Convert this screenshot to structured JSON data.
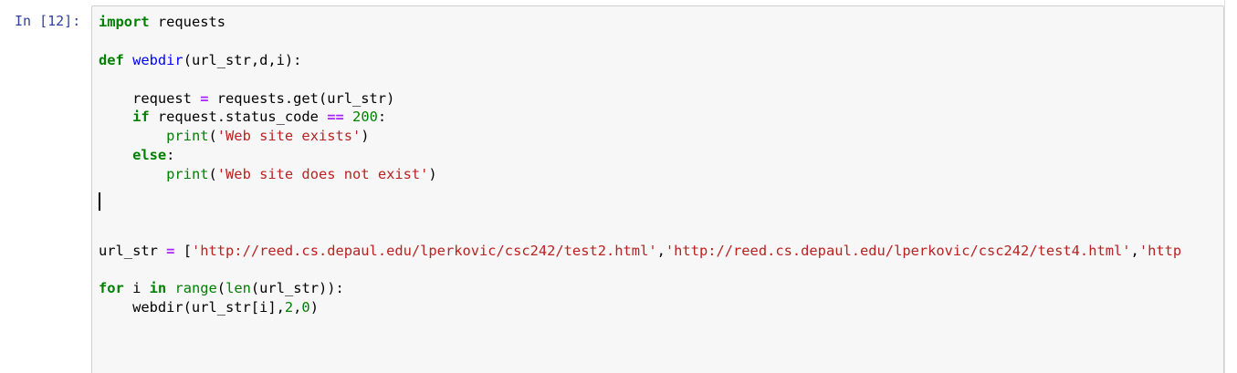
{
  "cell": {
    "prompt": "In [12]:"
  },
  "code": {
    "import_kw": "import",
    "import_mod": " requests",
    "def_kw": "def",
    "def_name": "webdir",
    "def_args": "(url_str,d,i):",
    "req_indent": "    request ",
    "req_op": "=",
    "req_rest": " requests.get(url_str)",
    "if_indent": "    ",
    "if_kw": "if",
    "if_cond": " request.status_code ",
    "if_op": "==",
    "if_sp": " ",
    "if_num": "200",
    "if_colon": ":",
    "p1_indent": "        ",
    "p1_fn": "print",
    "p1_open": "(",
    "p1_str": "'Web site exists'",
    "p1_close": ")",
    "else_indent": "    ",
    "else_kw": "else",
    "else_colon": ":",
    "p2_indent": "        ",
    "p2_fn": "print",
    "p2_open": "(",
    "p2_str": "'Web site does not exist'",
    "p2_close": ")",
    "url_var": "url_str ",
    "url_op": "=",
    "url_open": " [",
    "url_s1": "'http://reed.cs.depaul.edu/lperkovic/csc242/test2.html'",
    "url_c1": ",",
    "url_s2": "'http://reed.cs.depaul.edu/lperkovic/csc242/test4.html'",
    "url_c2": ",",
    "url_s3": "'http",
    "for_kw": "for",
    "for_var": " i ",
    "in_kw": "in",
    "for_sp": " ",
    "range_fn": "range",
    "for_paren": "(",
    "len_fn": "len",
    "for_rest": "(url_str)):",
    "call_indent": "    webdir(url_str[i],",
    "call_n1": "2",
    "call_comma": ",",
    "call_n2": "0",
    "call_close": ")"
  },
  "colors": {
    "prompt": "#303f9f",
    "keyword": "#008000",
    "function_name": "#0000ff",
    "operator": "#aa22ff",
    "string": "#ba2121",
    "cell_background": "#f7f7f7"
  }
}
